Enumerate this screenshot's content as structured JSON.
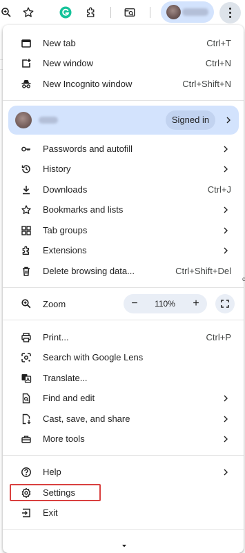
{
  "toolbar": {
    "icons": [
      "zoom-icon",
      "star-icon",
      "grammarly-icon",
      "extensions-icon",
      "tab-search-icon"
    ],
    "kebab_icon": "more-vert-icon"
  },
  "menu": {
    "group1": [
      {
        "label": "New tab",
        "shortcut": "Ctrl+T",
        "icon": "new-tab-icon"
      },
      {
        "label": "New window",
        "shortcut": "Ctrl+N",
        "icon": "new-window-icon"
      },
      {
        "label": "New Incognito window",
        "shortcut": "Ctrl+Shift+N",
        "icon": "incognito-icon"
      }
    ],
    "profile": {
      "signed_in_label": "Signed in"
    },
    "group2": [
      {
        "label": "Passwords and autofill",
        "icon": "key-icon",
        "submenu": true
      },
      {
        "label": "History",
        "icon": "history-icon",
        "submenu": true
      },
      {
        "label": "Downloads",
        "shortcut": "Ctrl+J",
        "icon": "download-icon"
      },
      {
        "label": "Bookmarks and lists",
        "icon": "star-icon",
        "submenu": true
      },
      {
        "label": "Tab groups",
        "icon": "tab-groups-icon",
        "submenu": true
      },
      {
        "label": "Extensions",
        "icon": "extensions-icon",
        "submenu": true
      },
      {
        "label": "Delete browsing data...",
        "shortcut": "Ctrl+Shift+Del",
        "icon": "trash-icon"
      }
    ],
    "zoom": {
      "label": "Zoom",
      "value": "110%",
      "minus": "−",
      "plus": "+"
    },
    "group3": [
      {
        "label": "Print...",
        "shortcut": "Ctrl+P",
        "icon": "print-icon"
      },
      {
        "label": "Search with Google Lens",
        "icon": "lens-icon"
      },
      {
        "label": "Translate...",
        "icon": "translate-icon"
      },
      {
        "label": "Find and edit",
        "icon": "find-icon",
        "submenu": true
      },
      {
        "label": "Cast, save, and share",
        "icon": "cast-icon",
        "submenu": true
      },
      {
        "label": "More tools",
        "icon": "toolbox-icon",
        "submenu": true
      }
    ],
    "group4": [
      {
        "label": "Help",
        "icon": "help-icon",
        "submenu": true
      },
      {
        "label": "Settings",
        "icon": "settings-icon"
      },
      {
        "label": "Exit",
        "icon": "exit-icon"
      }
    ]
  },
  "colors": {
    "profile_bg": "#d3e3fd",
    "highlight": "#d9403f",
    "text": "#1f1f1f"
  }
}
